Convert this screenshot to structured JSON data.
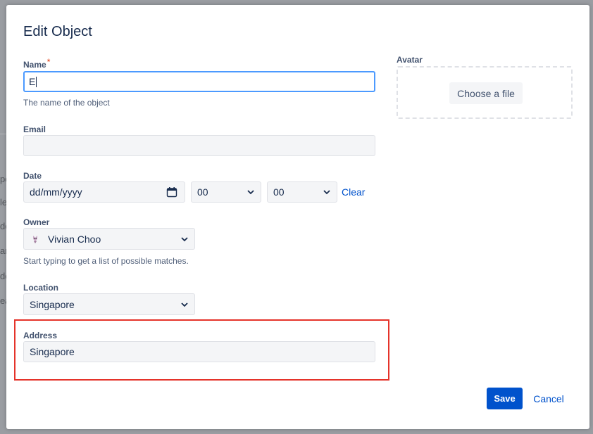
{
  "background": {
    "fragments": [
      "pe",
      "le",
      "de",
      "an",
      "de",
      "ea"
    ]
  },
  "dialog": {
    "title": "Edit Object",
    "name": {
      "label": "Name",
      "required_marker": "*",
      "value": "E",
      "help": "The name of the object"
    },
    "email": {
      "label": "Email",
      "value": ""
    },
    "date": {
      "label": "Date",
      "placeholder": "dd/mm/yyyy",
      "hour": "00",
      "minute": "00",
      "clear_label": "Clear"
    },
    "owner": {
      "label": "Owner",
      "value": "Vivian Choo",
      "help": "Start typing to get a list of possible matches."
    },
    "location": {
      "label": "Location",
      "value": "Singapore"
    },
    "address": {
      "label": "Address",
      "value": "Singapore"
    },
    "avatar": {
      "label": "Avatar",
      "button_label": "Choose a file"
    },
    "footer": {
      "save_label": "Save",
      "cancel_label": "Cancel"
    }
  },
  "colors": {
    "primary": "#0052cc",
    "focus_border": "#4c9aff",
    "highlight_box": "#e5332a",
    "required": "#de350b"
  }
}
